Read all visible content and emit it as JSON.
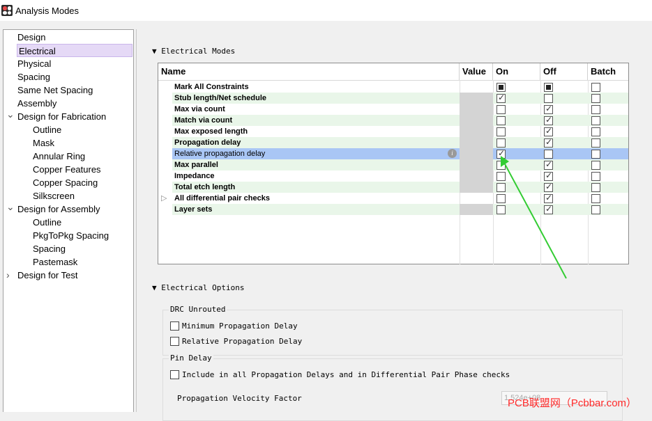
{
  "window": {
    "title": "Analysis Modes"
  },
  "tree": [
    {
      "label": "Design",
      "indent": 0
    },
    {
      "label": "Electrical",
      "indent": 0,
      "selected": true
    },
    {
      "label": "Physical",
      "indent": 0
    },
    {
      "label": "Spacing",
      "indent": 0
    },
    {
      "label": "Same Net Spacing",
      "indent": 0
    },
    {
      "label": "Assembly",
      "indent": 0
    },
    {
      "label": "Design for Fabrication",
      "indent": 0,
      "expander": "expanded"
    },
    {
      "label": "Outline",
      "indent": 1
    },
    {
      "label": "Mask",
      "indent": 1
    },
    {
      "label": "Annular Ring",
      "indent": 1
    },
    {
      "label": "Copper Features",
      "indent": 1
    },
    {
      "label": "Copper Spacing",
      "indent": 1
    },
    {
      "label": "Silkscreen",
      "indent": 1
    },
    {
      "label": "Design for Assembly",
      "indent": 0,
      "expander": "expanded"
    },
    {
      "label": "Outline",
      "indent": 1
    },
    {
      "label": "PkgToPkg Spacing",
      "indent": 1
    },
    {
      "label": "Spacing",
      "indent": 1
    },
    {
      "label": "Pastemask",
      "indent": 1
    },
    {
      "label": "Design for Test",
      "indent": 0,
      "expander": "collapsed"
    }
  ],
  "electrical_modes": {
    "header": "Electrical Modes",
    "columns": {
      "name": "Name",
      "value": "Value",
      "on": "On",
      "off": "Off",
      "batch": "Batch"
    },
    "rows": [
      {
        "name": "Mark All Constraints",
        "on": "fill",
        "off": "fill",
        "batch": "none",
        "value_gray": false
      },
      {
        "name": "Stub length/Net schedule",
        "on": "chk",
        "off": "none",
        "batch": "none",
        "value_gray": true
      },
      {
        "name": "Max via count",
        "on": "none",
        "off": "chk",
        "batch": "none",
        "value_gray": true
      },
      {
        "name": "Match via count",
        "on": "none",
        "off": "chk",
        "batch": "none",
        "value_gray": true
      },
      {
        "name": "Max exposed length",
        "on": "none",
        "off": "chk",
        "batch": "none",
        "value_gray": true
      },
      {
        "name": "Propagation delay",
        "on": "none",
        "off": "chk",
        "batch": "none",
        "value_gray": true
      },
      {
        "name": "Relative propagation delay",
        "on": "chk",
        "off": "none",
        "batch": "none",
        "value_gray": true,
        "selected": true
      },
      {
        "name": "Max parallel",
        "on": "none",
        "off": "chk",
        "batch": "none",
        "value_gray": true
      },
      {
        "name": "Impedance",
        "on": "none",
        "off": "chk",
        "batch": "none",
        "value_gray": true
      },
      {
        "name": "Total etch length",
        "on": "none",
        "off": "chk",
        "batch": "none",
        "value_gray": true
      },
      {
        "name": "All differential pair checks",
        "on": "none",
        "off": "chk",
        "batch": "none",
        "value_gray": false,
        "expander": true
      },
      {
        "name": "Layer sets",
        "on": "none",
        "off": "chk",
        "batch": "none",
        "value_gray": true
      }
    ]
  },
  "electrical_options": {
    "header": "Electrical Options",
    "drc_unrouted": {
      "legend": "DRC Unrouted",
      "options": [
        "Minimum Propagation Delay",
        "Relative Propagation Delay"
      ]
    },
    "pin_delay": {
      "legend": "Pin Delay",
      "include_label": "Include in all Propagation Delays and in Differential Pair Phase checks",
      "velocity_label": "Propagation Velocity Factor",
      "velocity_value": "1.524e+08"
    }
  },
  "watermark": "PCB联盟网（Pcbbar.com）",
  "colors": {
    "selected_tree": "#e5d9f6",
    "selected_row": "#a9c6f5",
    "alt_row": "#e9f6e9",
    "arrow": "#33cc33",
    "watermark": "#ff2a2a"
  }
}
